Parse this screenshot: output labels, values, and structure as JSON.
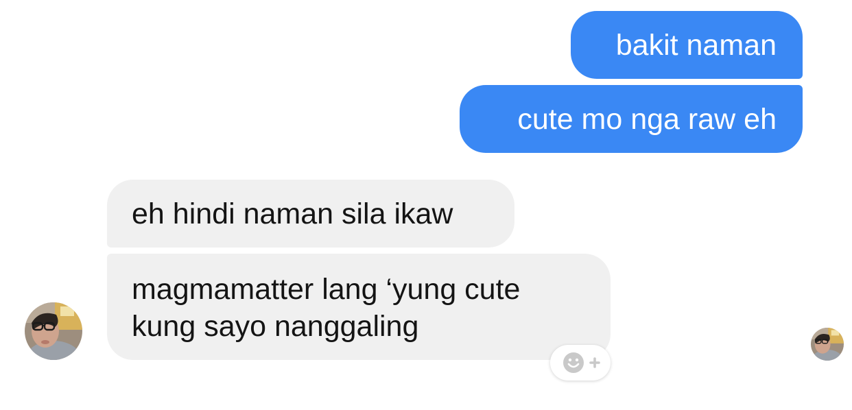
{
  "messages": {
    "sent": [
      {
        "text": "bakit naman"
      },
      {
        "text": "cute mo nga raw eh"
      }
    ],
    "received": [
      {
        "text": "eh hindi naman sila ikaw"
      },
      {
        "text": "magmamatter lang ‘yung cute kung sayo nanggaling"
      }
    ]
  },
  "colors": {
    "sent_bubble": "#3a88f4",
    "received_bubble": "#f0f0f0",
    "reaction_icon": "#c9c9c9"
  },
  "icons": {
    "contact_avatar": "avatar",
    "read_receipt": "avatar",
    "add_reaction": "smiley-plus-icon"
  }
}
